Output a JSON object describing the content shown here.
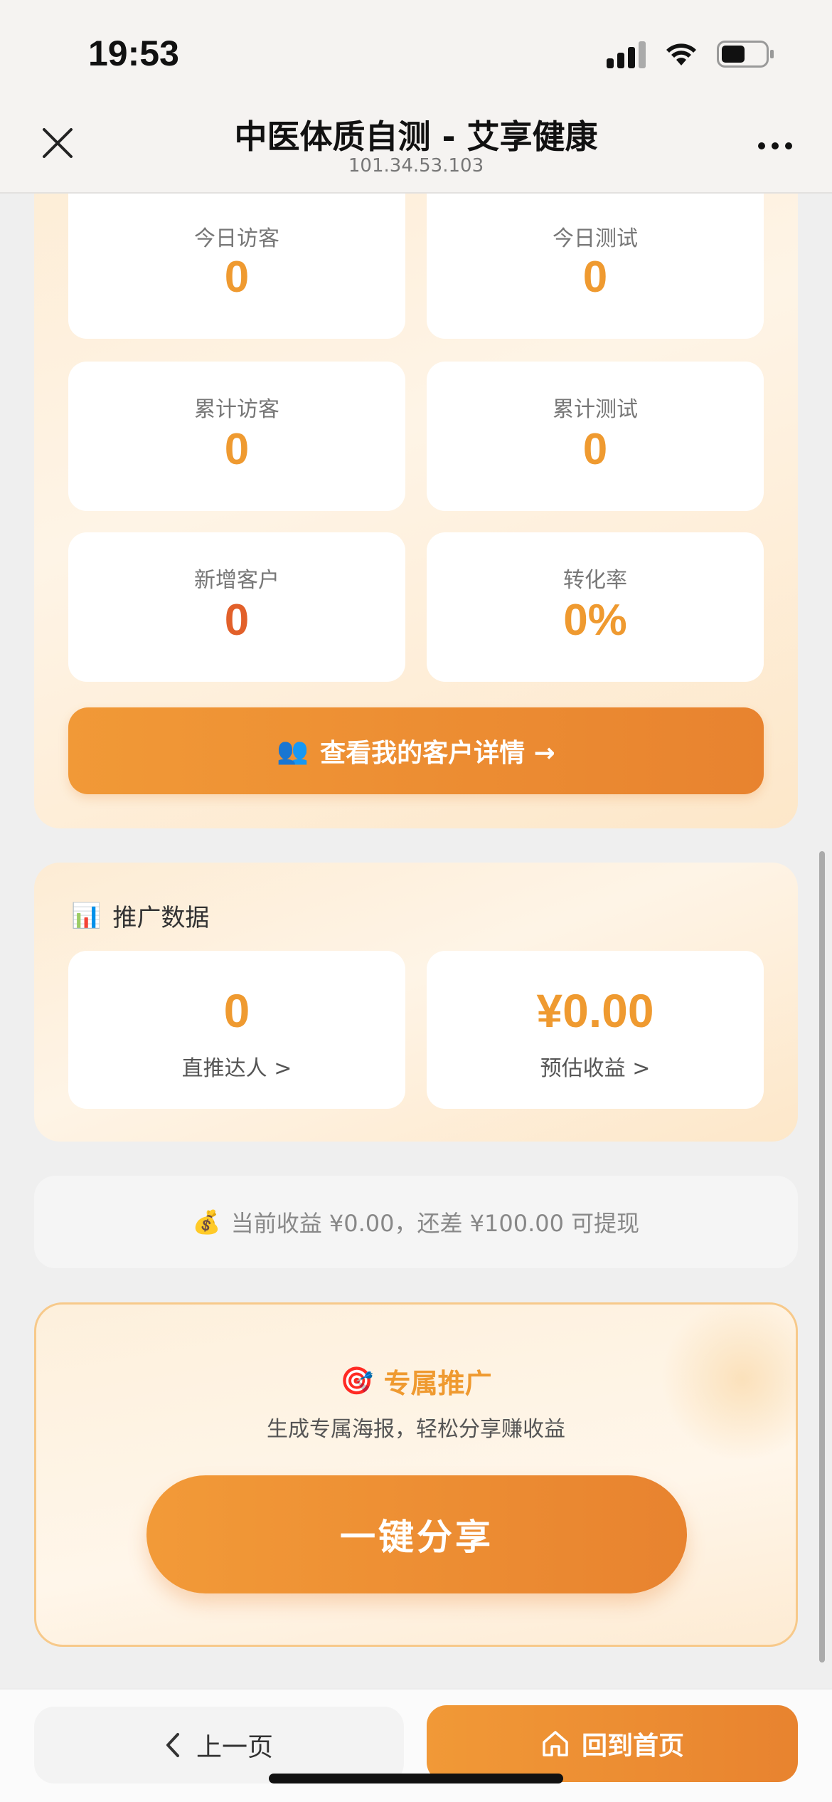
{
  "status_bar": {
    "time": "19:53"
  },
  "nav": {
    "title": "中医体质自测 - 艾享健康",
    "subtitle": "101.34.53.103"
  },
  "stats": [
    {
      "label": "今日访客",
      "value": "0"
    },
    {
      "label": "今日测试",
      "value": "0"
    },
    {
      "label": "累计访客",
      "value": "0"
    },
    {
      "label": "累计测试",
      "value": "0"
    },
    {
      "label": "新增客户",
      "value": "0"
    },
    {
      "label": "转化率",
      "value": "0%"
    }
  ],
  "customer_button": {
    "icon": "👥",
    "label": "查看我的客户详情 →"
  },
  "promo": {
    "icon": "📊",
    "title": "推广数据",
    "cards": [
      {
        "value": "0",
        "label": "直推达人 >"
      },
      {
        "value": "¥0.00",
        "label": "预估收益 >"
      }
    ]
  },
  "notice": {
    "icon": "💰",
    "text": "当前收益 ¥0.00，还差 ¥100.00 可提现"
  },
  "share": {
    "icon": "🎯",
    "title": "专属推广",
    "subtitle": "生成专属海报，轻松分享赚收益",
    "button_label": "一键分享"
  },
  "bottom_bar": {
    "prev_label": "上一页",
    "home_label": "回到首页"
  },
  "colors": {
    "accent": "#ef9a30",
    "accent_dark": "#e8832f",
    "value_red": "#e2602a"
  }
}
